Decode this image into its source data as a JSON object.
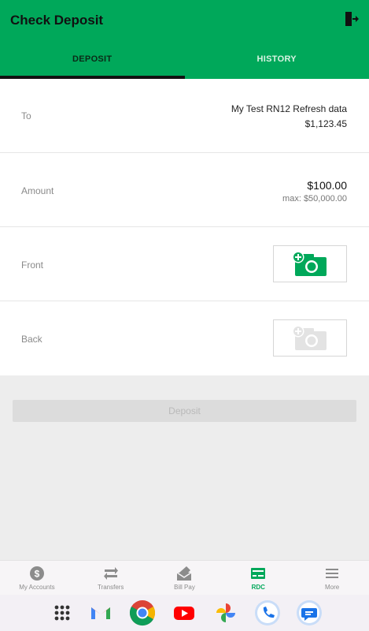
{
  "header": {
    "title": "Check Deposit",
    "logout_icon": "logout-icon"
  },
  "tabs": [
    {
      "label": "DEPOSIT",
      "active": true
    },
    {
      "label": "HISTORY",
      "active": false
    }
  ],
  "form": {
    "to": {
      "label": "To",
      "account_name": "My Test RN12 Refresh data",
      "balance": "$1,123.45"
    },
    "amount": {
      "label": "Amount",
      "value": "$100.00",
      "max": "max: $50,000.00"
    },
    "front": {
      "label": "Front",
      "icon": "add-photo-icon",
      "enabled": true
    },
    "back": {
      "label": "Back",
      "icon": "add-photo-icon",
      "enabled": false
    }
  },
  "deposit_button": {
    "label": "Deposit",
    "enabled": false
  },
  "bottom_nav": [
    {
      "label": "My Accounts",
      "icon": "dollar-circle-icon",
      "active": false
    },
    {
      "label": "Transfers",
      "icon": "transfer-arrows-icon",
      "active": false
    },
    {
      "label": "Bill Pay",
      "icon": "bill-pay-icon",
      "active": false
    },
    {
      "label": "RDC",
      "icon": "check-icon",
      "active": true
    },
    {
      "label": "More",
      "icon": "menu-icon",
      "active": false
    }
  ],
  "dock": [
    "app-drawer-icon",
    "gmail-icon",
    "chrome-icon",
    "youtube-icon",
    "photos-icon",
    "phone-icon",
    "messages-icon"
  ],
  "colors": {
    "brand_green": "#00a85a",
    "background": "#ededed"
  }
}
